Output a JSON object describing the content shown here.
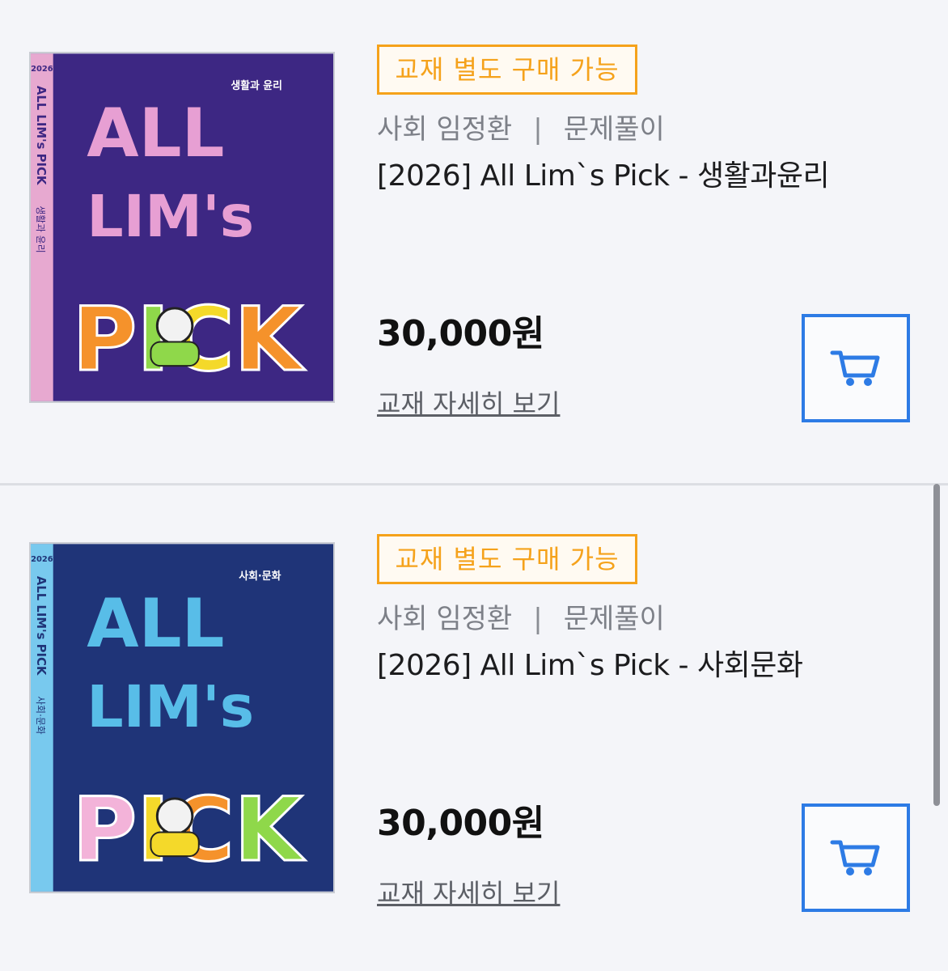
{
  "products": [
    {
      "badge": "교재 별도 구매 가능",
      "subject": "사회 임정환",
      "separator": "|",
      "category": "문제풀이",
      "title": "[2026] All Lim`s Pick - 생활과윤리",
      "price": "30,000원",
      "detail_link": "교재 자세히 보기",
      "cover": {
        "bg": "#3d2783",
        "spine_bg": "#e7a9d0",
        "title_color": "#e79fd3",
        "spine_year": "2026",
        "spine_text": "ALL LIM's PICK",
        "spine_subject": "생활과 윤리",
        "corner_label": "생활과 윤리",
        "big_title_1": "ALL",
        "big_title_2": "LIM's",
        "pick": "PICK",
        "pick_colors": [
          "#f5922b",
          "#8fd84a",
          "#f4d92a",
          "#f5922b",
          "#6cc7f0"
        ]
      }
    },
    {
      "badge": "교재 별도 구매 가능",
      "subject": "사회 임정환",
      "separator": "|",
      "category": "문제풀이",
      "title": "[2026] All Lim`s Pick - 사회문화",
      "price": "30,000원",
      "detail_link": "교재 자세히 보기",
      "cover": {
        "bg": "#1f3478",
        "spine_bg": "#78c9ee",
        "title_color": "#58bde8",
        "spine_year": "2026",
        "spine_text": "ALL LIM's PICK",
        "spine_subject": "사회·문화",
        "corner_label": "사회·문화",
        "big_title_1": "ALL",
        "big_title_2": "LIM's",
        "pick": "PICK",
        "pick_colors": [
          "#f3b3d9",
          "#f4d92a",
          "#f5922b",
          "#8fd84a",
          "#8fd84a"
        ]
      }
    }
  ],
  "colors": {
    "badge": "#f5a21b",
    "cart": "#2d7be5"
  },
  "icons": {
    "cart": "shopping-cart-icon"
  }
}
